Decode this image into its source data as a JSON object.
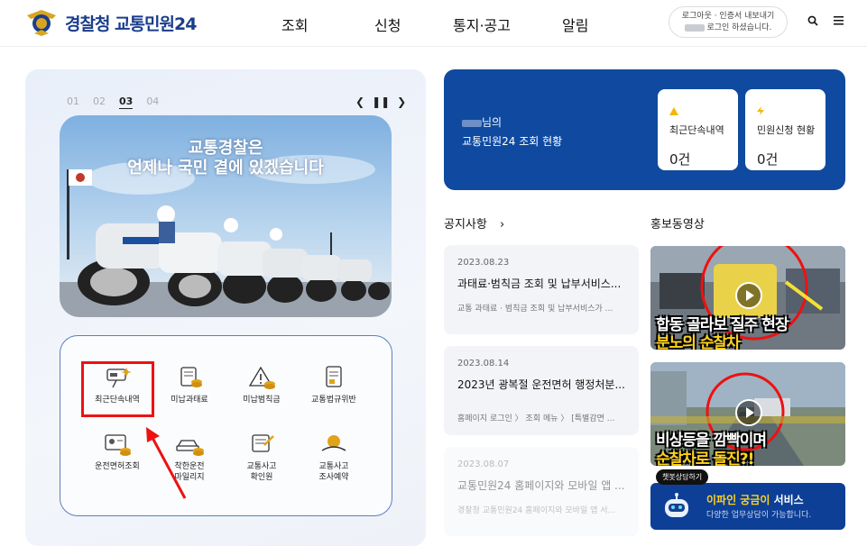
{
  "header": {
    "logo_text": "경찰청 교통민원24",
    "nav": [
      "조회",
      "신청",
      "통지·공고",
      "알림"
    ],
    "login_line1": "로그아웃 · 인증서 내보내기",
    "login_line2_suffix": "로그인 하셨습니다.",
    "icons": [
      "search-icon",
      "menu-icon"
    ]
  },
  "banner": {
    "pages": [
      "01",
      "02",
      "03",
      "04"
    ],
    "active_page": "03",
    "title_line1": "교통경찰은",
    "title_line2": "언제나 국민 곁에 있겠습니다"
  },
  "quick_menu": [
    {
      "label": "최근단속내역"
    },
    {
      "label": "미납과태료"
    },
    {
      "label": "미납범칙금"
    },
    {
      "label": "교통법규위반"
    },
    {
      "label": "운전면허조회"
    },
    {
      "label": "착한운전\n마일리지"
    },
    {
      "label": "교통사고\n확인원"
    },
    {
      "label": "교통사고\n조사예약"
    }
  ],
  "status": {
    "name_suffix": "님의",
    "title": "교통민원24 조회 현황",
    "cards": [
      {
        "label": "최근단속내역",
        "value": "0건",
        "icon": "warning-icon"
      },
      {
        "label": "민원신청 현황",
        "value": "0건",
        "icon": "lightning-icon"
      }
    ]
  },
  "notices": {
    "title": "공지사항",
    "items": [
      {
        "date": "2023.08.23",
        "title": "과태료·범칙금 조회 및 납부서비스...",
        "summary": "교통 과태료 · 범칙금 조회 및 납부서비스가 ..."
      },
      {
        "date": "2023.08.14",
        "title": "2023년 광복절 운전면허 행정처분...",
        "summary": "홈페이지 로그인 〉 조회 메뉴 〉 [특별감면 ..."
      },
      {
        "date": "2023.08.07",
        "title": "교통민원24 홈페이지와 모바일 앱 ...",
        "summary": "경찰청 교통민원24 홈페이지와 모바일 앱 서..."
      }
    ]
  },
  "promo": {
    "title": "홍보동영상",
    "videos": [
      {
        "caption1": "합동 골라보 질주 현장",
        "caption2": "분노의 순찰차"
      },
      {
        "caption1": "비상등을 깜빡이며",
        "caption2": "순찰차로 돌진?!"
      }
    ]
  },
  "chatbot": {
    "tag": "챗봇상담하기",
    "title_highlight": "이파인 궁금이",
    "title_rest": " 서비스",
    "subtitle": "다양한 업무상담이 가능합니다."
  }
}
